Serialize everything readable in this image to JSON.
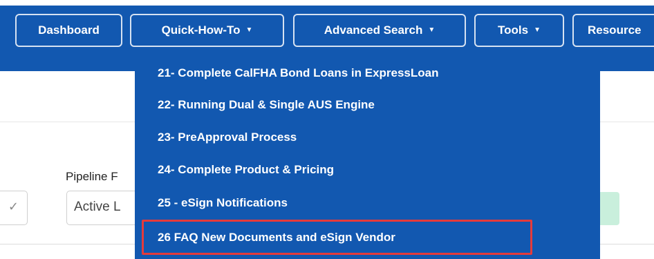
{
  "nav": {
    "dashboard": "Dashboard",
    "quick_how_to": "Quick-How-To",
    "advanced_search": "Advanced Search",
    "tools": "Tools",
    "resources": "Resource"
  },
  "dropdown": {
    "items": [
      "21- Complete CalFHA Bond Loans in ExpressLoan",
      "22- Running Dual & Single AUS Engine",
      "23- PreApproval Process",
      "24- Complete Product & Pricing",
      "25 - eSign Notifications",
      "26 FAQ New Documents and eSign Vendor"
    ]
  },
  "pipeline": {
    "label": "Pipeline F",
    "filter_value": "Active L"
  },
  "colors": {
    "nav_blue": "#1258b0",
    "highlight_red": "#e53b3b",
    "pill_green": "#c9efdc"
  }
}
